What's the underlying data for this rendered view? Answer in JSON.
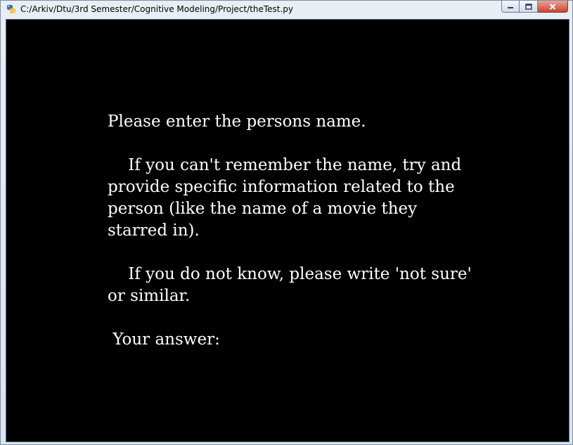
{
  "window": {
    "title": "C:/Arkiv/Dtu/3rd Semester/Cognitive Modeling/Project/theTest.py",
    "icon": "python-icon",
    "buttons": [
      "minimize-icon",
      "maximize-icon",
      "close-icon"
    ]
  },
  "content": {
    "line1": "Please enter the persons name.",
    "para2": "    If you can't remember the name, try and provide specific information related to the person (like the name of a movie they starred in).",
    "para3": "    If you do not know, please write 'not sure' or similar.",
    "answer_label": " Your answer:"
  },
  "colors": {
    "background": "#000000",
    "text": "#ffffff"
  }
}
